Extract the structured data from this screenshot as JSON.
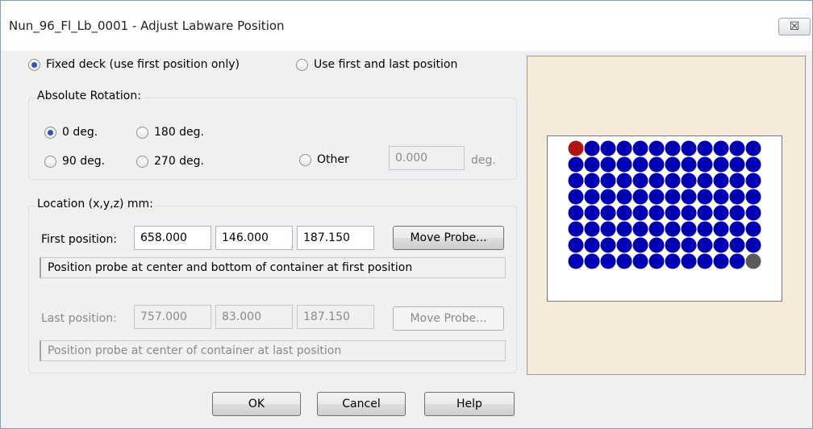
{
  "window": {
    "title": "Nun_96_Fl_Lb_0001 - Adjust Labware Position",
    "close_glyph": "☒"
  },
  "mode": {
    "fixed_label": "Fixed deck (use first position only)",
    "first_last_label": "Use first and last position",
    "selected": "fixed"
  },
  "rotation": {
    "group_title": "Absolute Rotation:",
    "options": [
      "0 deg.",
      "180 deg.",
      "90 deg.",
      "270 deg."
    ],
    "other_label": "Other",
    "other_value": "0.000",
    "other_unit": "deg.",
    "selected": "0 deg."
  },
  "location": {
    "group_title": "Location (x,y,z) mm:",
    "first_label": "First position:",
    "first_x": "658.000",
    "first_y": "146.000",
    "first_z": "187.150",
    "first_probe_button": "Move Probe...",
    "first_info": "Position probe at center and bottom of container at first position",
    "last_label": "Last position:",
    "last_x": "757.000",
    "last_y": "83.000",
    "last_z": "187.150",
    "last_probe_button": "Move Probe...",
    "last_info": "Position probe at center of container at last position"
  },
  "buttons": {
    "ok": "OK",
    "cancel": "Cancel",
    "help": "Help"
  },
  "plate": {
    "rows": 8,
    "columns": 12,
    "well_color": "#0000b4",
    "first_well_color": "#b41414",
    "last_well_color": "#5a5a5a",
    "background": "#f5ead9"
  }
}
